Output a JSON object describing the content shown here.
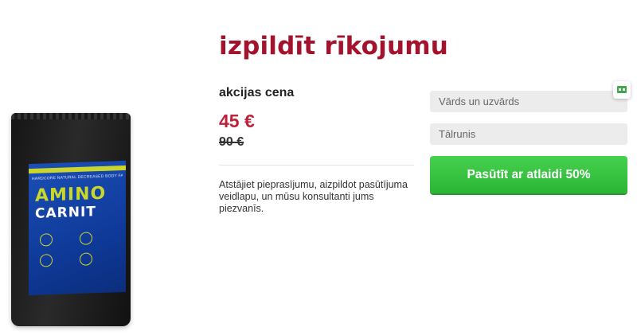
{
  "page": {
    "title": "izpildīt rīkojumu",
    "accent_color": "#a3132d"
  },
  "product": {
    "image_alt_icon": "product-package-icon",
    "pack_subtitle": "HARDCORE NATURAL DECREASED BODY FAT",
    "brand_line1": "AMINO",
    "brand_line2": "CARNIT"
  },
  "offer": {
    "promo_label": "akcijas cena",
    "price_new": "45 €",
    "price_old": "90 €",
    "info_text": "Atstājiet pieprasījumu, aizpildot pasūtījuma veidlapu, un mūsu konsultanti jums piezvanīs.",
    "price_color": "#c0213a"
  },
  "form": {
    "name_placeholder": "Vārds un uzvārds",
    "name_value": "",
    "phone_placeholder": "Tālrunis",
    "phone_value": "",
    "submit_label": "Pasūtīt ar atlaidi 50%",
    "button_color": "#2cb535"
  },
  "widget": {
    "icon": "chat-widget-icon"
  }
}
